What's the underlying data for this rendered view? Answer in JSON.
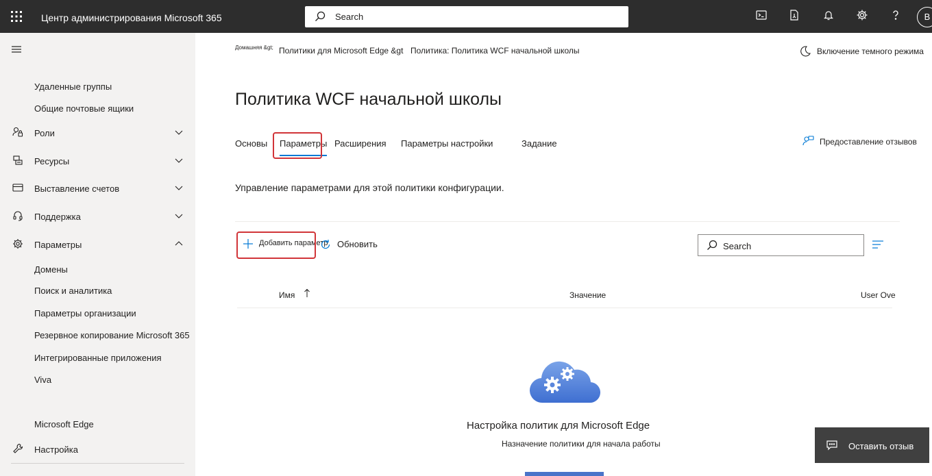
{
  "topbar": {
    "app_title": "Центр администрирования Microsoft 365",
    "search_placeholder": "Search",
    "avatar_initial": "B"
  },
  "sidebar": {
    "items": [
      {
        "label": "Удаленные группы"
      },
      {
        "label": "Общие почтовые ящики"
      },
      {
        "label": "Роли",
        "icon": "roles-icon"
      },
      {
        "label": "Ресурсы",
        "icon": "resources-icon"
      },
      {
        "label": "Выставление счетов",
        "icon": "billing-icon"
      },
      {
        "label": "Поддержка",
        "icon": "headset-icon"
      },
      {
        "label": "Параметры",
        "icon": "gear-icon"
      },
      {
        "label": "Домены"
      },
      {
        "label": "Поиск и аналитика"
      },
      {
        "label": "Параметры организации"
      },
      {
        "label": "Резервное копирование Microsoft 365"
      },
      {
        "label": "Интегрированные приложения"
      },
      {
        "label": "Viva"
      },
      {
        "label": "Microsoft Edge"
      },
      {
        "label": "Настройка",
        "icon": "wrench-icon"
      }
    ]
  },
  "breadcrumb": {
    "home": "Домашняя &gt;",
    "item1": "Политики для Microsoft Edge &gt",
    "item2": "Политика: Политика WCF начальной школы"
  },
  "dark_mode_label": "Включение темного режима",
  "page_title": "Политика WCF начальной школы",
  "tabs": [
    {
      "label": "Основы"
    },
    {
      "label": "Параметры"
    },
    {
      "label": "Расширения"
    },
    {
      "label": "Параметры настройки"
    },
    {
      "label": "Задание"
    }
  ],
  "feedback_link": "Предоставление отзывов",
  "description": "Управление параметрами для этой политики конфигурации.",
  "commands": {
    "add": "Добавить параметр",
    "refresh": "Обновить"
  },
  "list_search_placeholder": "Search",
  "columns": {
    "name": "Имя",
    "value": "Значение",
    "user_override": "User Ove"
  },
  "empty_state": {
    "title": "Настройка политик для Microsoft Edge",
    "subtitle": "Назначение политики для начала работы"
  },
  "float_feedback": "Оставить отзыв",
  "colors": {
    "accent": "#0078d4",
    "highlight_box": "#d13438",
    "topbar": "#2d2d2d",
    "sidebar": "#f3f2f1"
  }
}
